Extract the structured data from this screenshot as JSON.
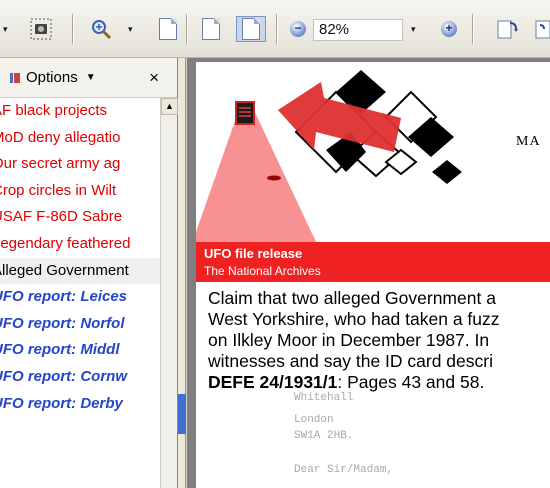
{
  "toolbar": {
    "zoom_value": "82%",
    "icons": [
      "snapshot-icon",
      "zoom-in-icon",
      "page-icon",
      "single-page-icon",
      "continuous-page-icon",
      "zoom-out-icon",
      "zoom-plus-icon",
      "rotate-icon"
    ]
  },
  "panel": {
    "title": "Options",
    "close_label": "×",
    "items": [
      {
        "label": "AF black projects",
        "style": "red"
      },
      {
        "label": "MoD deny allegatio",
        "style": "red"
      },
      {
        "label": "Our secret army ag",
        "style": "red"
      },
      {
        "label": "Crop circles in Wilt",
        "style": "red"
      },
      {
        "label": "USAF F-86D Sabre",
        "style": "red"
      },
      {
        "label": "Legendary feathered",
        "style": "red"
      },
      {
        "label": "Alleged Government",
        "style": "sel"
      },
      {
        "label": "UFO report: Leices",
        "style": "blue"
      },
      {
        "label": "UFO report: Norfol",
        "style": "blue"
      },
      {
        "label": "UFO report: Middl",
        "style": "blue"
      },
      {
        "label": "UFO report: Cornw",
        "style": "blue"
      },
      {
        "label": "UFO report: Derby",
        "style": "blue"
      }
    ]
  },
  "document": {
    "header_letters": "MA",
    "banner_title": "UFO file release",
    "banner_subtitle": "The National Archives",
    "line1": "Claim that two alleged Government a",
    "line2": "West Yorkshire, who had taken a fuzz",
    "line3": "on Ilkley Moor in December 1987. In",
    "line4": "witnesses and say the ID card descri",
    "ref": "DEFE 24/1931/1",
    "ref_rest": ": Pages 43 and 58.",
    "faded1": "Whitehall",
    "faded2": "London",
    "faded3": "SW1A 2HB.",
    "faded4": "Dear Sir/Madam,"
  },
  "colors": {
    "red_item": "#e00000",
    "blue_item": "#2446c8",
    "banner": "#ee2222"
  }
}
